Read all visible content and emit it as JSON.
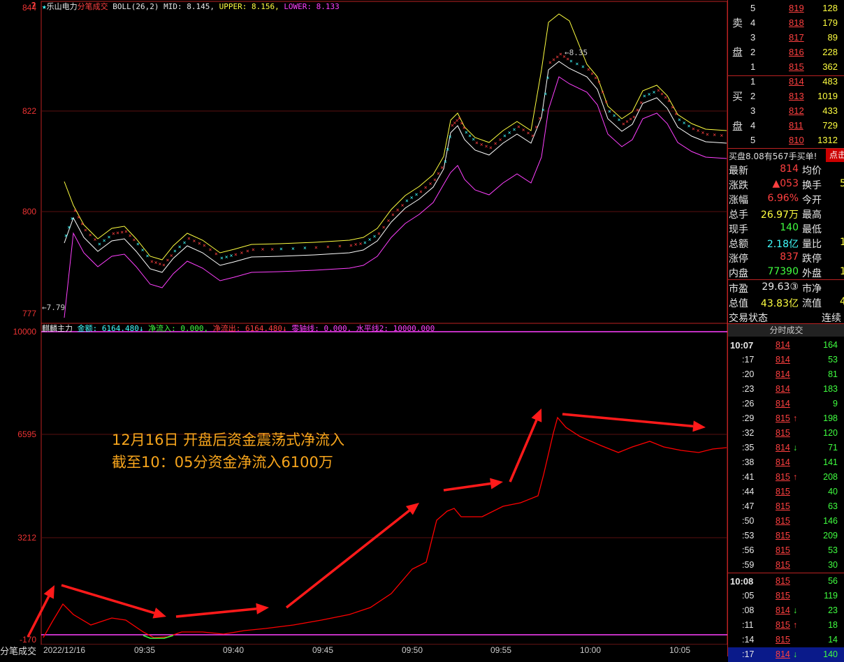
{
  "header": {
    "star": "★",
    "stock_name": "乐山电力",
    "mode": "分笔成交",
    "boll": "BOLL(26,2)",
    "mid": "MID: 8.145,",
    "upper": "UPPER: 8.156,",
    "lower": "LOWER: 8.133"
  },
  "price_axis": {
    "top": "844",
    "mid1": "822",
    "mid2": "800",
    "bottom": "777",
    "question": "?"
  },
  "price_marks": {
    "high": "8.35",
    "low": "7.79"
  },
  "indicator": {
    "name": "麒麟主力",
    "amount": "金额: 6164.480↓",
    "inflow": "净流入: 0.000,",
    "outflow": "净流出: 6164.480↓",
    "zero": "零轴线: 0.000,",
    "level": "水平线2: 10000.000"
  },
  "ind_axis": [
    "10000",
    "6595",
    "3212",
    "-170"
  ],
  "annotation": [
    "12月16日 开盘后资金震荡式净流入",
    "截至10：05分资金净流入6100万"
  ],
  "time_axis": {
    "bottom_tab": "分笔成交",
    "date": "2022/12/16",
    "ticks": [
      "09:35",
      "09:40",
      "09:45",
      "09:50",
      "09:55",
      "10:00",
      "10:05"
    ]
  },
  "order_book": {
    "sell_label": [
      "卖",
      "盘"
    ],
    "buy_label": [
      "买",
      "盘"
    ],
    "sells": [
      {
        "level": "5",
        "price": "819",
        "vol": "128"
      },
      {
        "level": "4",
        "price": "818",
        "vol": "179"
      },
      {
        "level": "3",
        "price": "817",
        "vol": "89"
      },
      {
        "level": "2",
        "price": "816",
        "vol": "228"
      },
      {
        "level": "1",
        "price": "815",
        "vol": "362"
      }
    ],
    "buys": [
      {
        "level": "1",
        "price": "814",
        "vol": "483"
      },
      {
        "level": "2",
        "price": "813",
        "vol": "1019"
      },
      {
        "level": "3",
        "price": "812",
        "vol": "433"
      },
      {
        "level": "4",
        "price": "811",
        "vol": "729"
      },
      {
        "level": "5",
        "price": "810",
        "vol": "1312"
      }
    ]
  },
  "notice": {
    "text": "买盘8.08有567手买单!",
    "button": "点击"
  },
  "quote": [
    {
      "l": "最新",
      "v": "814",
      "l2": "均价",
      "v2": ""
    },
    {
      "l": "涨跌",
      "v": "▲053",
      "l2": "换手",
      "v2": "5"
    },
    {
      "l": "涨幅",
      "v": "6.96%",
      "l2": "今开",
      "v2": ""
    },
    {
      "l": "总手",
      "v": "26.97万",
      "l2": "最高",
      "v2": ""
    },
    {
      "l": "现手",
      "v": "140",
      "l2": "最低",
      "v2": ""
    },
    {
      "l": "总额",
      "v": "2.18亿",
      "l2": "量比",
      "v2": "1"
    },
    {
      "l": "涨停",
      "v": "837",
      "l2": "跌停",
      "v2": ""
    },
    {
      "l": "内盘",
      "v": "77390",
      "l2": "外盘",
      "v2": "19."
    },
    {
      "l": "市盈",
      "v": "29.63③",
      "l2": "市净",
      "v2": ""
    },
    {
      "l": "总值",
      "v": "43.83亿",
      "l2": "流值",
      "v2": "43."
    },
    {
      "l": "交易状态",
      "v": "",
      "l2": "连续",
      "v2": ""
    }
  ],
  "ticks_title": "分时成交",
  "ticks": [
    {
      "t": "10:07",
      "p": "814",
      "a": "",
      "v": "164"
    },
    {
      "t": ":17",
      "p": "814",
      "a": "",
      "v": "53"
    },
    {
      "t": ":20",
      "p": "814",
      "a": "",
      "v": "81"
    },
    {
      "t": ":23",
      "p": "814",
      "a": "",
      "v": "183"
    },
    {
      "t": ":26",
      "p": "814",
      "a": "",
      "v": "9"
    },
    {
      "t": ":29",
      "p": "815",
      "a": "↑",
      "v": "198"
    },
    {
      "t": ":32",
      "p": "815",
      "a": "",
      "v": "120"
    },
    {
      "t": ":35",
      "p": "814",
      "a": "↓",
      "v": "71"
    },
    {
      "t": ":38",
      "p": "814",
      "a": "",
      "v": "141"
    },
    {
      "t": ":41",
      "p": "815",
      "a": "↑",
      "v": "208"
    },
    {
      "t": ":44",
      "p": "815",
      "a": "",
      "v": "40"
    },
    {
      "t": ":47",
      "p": "815",
      "a": "",
      "v": "63"
    },
    {
      "t": ":50",
      "p": "815",
      "a": "",
      "v": "146"
    },
    {
      "t": ":53",
      "p": "815",
      "a": "",
      "v": "209"
    },
    {
      "t": ":56",
      "p": "815",
      "a": "",
      "v": "53"
    },
    {
      "t": ":59",
      "p": "815",
      "a": "",
      "v": "30"
    },
    {
      "t": "10:08",
      "p": "815",
      "a": "",
      "v": "56"
    },
    {
      "t": ":05",
      "p": "815",
      "a": "",
      "v": "119"
    },
    {
      "t": ":08",
      "p": "814",
      "a": "↓",
      "v": "23"
    },
    {
      "t": ":11",
      "p": "815",
      "a": "↑",
      "v": "18"
    },
    {
      "t": ":14",
      "p": "815",
      "a": "",
      "v": "14"
    },
    {
      "t": ":17",
      "p": "814",
      "a": "↓",
      "v": "140"
    }
  ],
  "colors": {
    "up": "#ff4040",
    "down": "#40ff40",
    "upper_band": "#ffff40",
    "mid_band": "#ffffff",
    "lower_band": "#ff40ff",
    "flow": "#ff0000",
    "annotation": "#f7a51c"
  }
}
